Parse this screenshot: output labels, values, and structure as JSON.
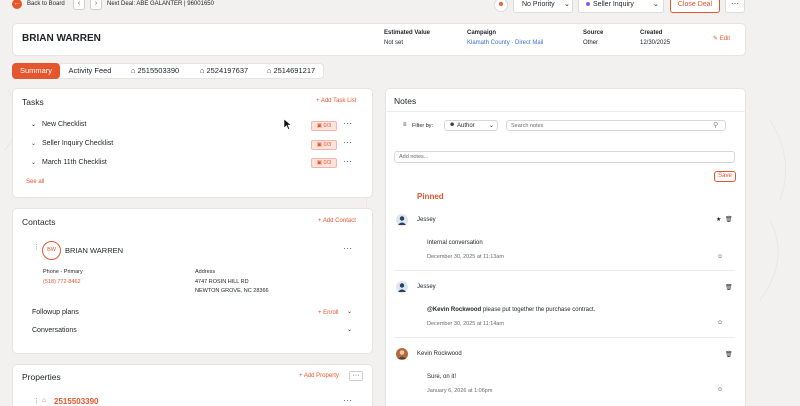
{
  "topbar": {
    "back_label": "Back to Board",
    "next_deal": "Next Deal: ABE GALANTER | 96001650",
    "priority": "No Priority",
    "status": "Seller Inquiry",
    "close_deal": "Close Deal",
    "more": "···"
  },
  "header": {
    "name": "BRIAN WARREN",
    "estimated_value_label": "Estimated Value",
    "estimated_value": "Not set",
    "campaign_label": "Campaign",
    "campaign": "Klamath County · Direct Mail",
    "source_label": "Source",
    "source": "Other",
    "created_label": "Created",
    "created": "12/30/2025",
    "edit": "Edit"
  },
  "tabs": [
    {
      "label": "Summary"
    },
    {
      "label": "Activity Feed"
    },
    {
      "label": "2515503390"
    },
    {
      "label": "2524197637"
    },
    {
      "label": "2514691217"
    }
  ],
  "tasks": {
    "title": "Tasks",
    "add": "+ Add Task List",
    "items": [
      {
        "label": "New Checklist",
        "badge": "0/3"
      },
      {
        "label": "Seller Inquiry Checklist",
        "badge": "0/3"
      },
      {
        "label": "March 11th Checklist",
        "badge": "0/3"
      }
    ],
    "see_all": "See all"
  },
  "contacts": {
    "title": "Contacts",
    "add": "+ Add Contact",
    "initials": "BW",
    "name": "BRIAN WARREN",
    "phone_label": "Phone - Primary",
    "phone": "(518) 772-8462",
    "address_label": "Address",
    "address_line1": "4747 ROSIN HILL RD",
    "address_line2": "NEWTON GROVE, NC 28366",
    "followup": "Followup plans",
    "enroll": "+ Enroll",
    "conversations": "Conversations"
  },
  "properties": {
    "title": "Properties",
    "add": "+ Add Property",
    "first": "2515503390"
  },
  "notes": {
    "title": "Notes",
    "filter_by": "Filter by:",
    "author": "Author",
    "search_placeholder": "Search notes",
    "add_placeholder": "Add notes...",
    "save": "Save",
    "pinned": "Pinned",
    "items": [
      {
        "author": "Jessey",
        "text": "Internal conversation",
        "mention": "",
        "date": "December 30, 2025 at 11:13am"
      },
      {
        "author": "Jessey",
        "text": "please put together the purchase contract.",
        "mention": "@Kevin Rockwood",
        "date": "December 30, 2025 at 11:14am"
      },
      {
        "author": "Kevin Rockwood",
        "text": "Sure, on it!",
        "mention": "",
        "date": "January 6, 2026 at 1:06pm"
      }
    ]
  },
  "colors": {
    "accent": "#e4572e",
    "background": "#f3f1ef"
  }
}
